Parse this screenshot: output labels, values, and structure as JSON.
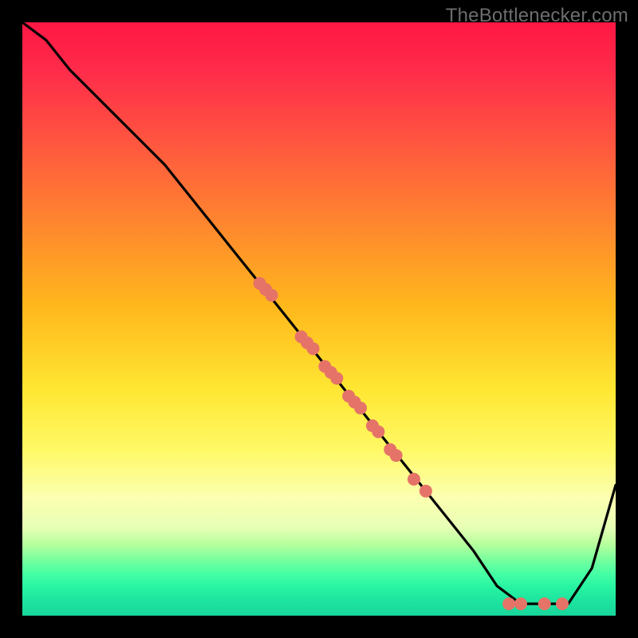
{
  "watermark": "TheBottlenecker.com",
  "colors": {
    "dot": "#e57368",
    "curve": "#000000",
    "frame_bg": "#000000"
  },
  "chart_data": {
    "type": "line",
    "title": "",
    "xlabel": "",
    "ylabel": "",
    "xlim": [
      0,
      100
    ],
    "ylim": [
      0,
      100
    ],
    "grid": false,
    "legend": false,
    "series": [
      {
        "name": "bottleneck-curve",
        "x": [
          0,
          4,
          8,
          12,
          16,
          20,
          24,
          28,
          32,
          36,
          40,
          44,
          48,
          52,
          56,
          60,
          64,
          68,
          72,
          76,
          80,
          84,
          88,
          92,
          96,
          100
        ],
        "y": [
          100,
          97,
          92,
          88,
          84,
          80,
          76,
          71,
          66,
          61,
          56,
          51,
          46,
          41,
          36,
          31,
          26,
          21,
          16,
          11,
          5,
          2,
          2,
          2,
          8,
          22
        ]
      }
    ],
    "scatter": [
      {
        "name": "points-on-curve",
        "points": [
          {
            "x": 40,
            "y": 56
          },
          {
            "x": 41,
            "y": 55
          },
          {
            "x": 42,
            "y": 54
          },
          {
            "x": 47,
            "y": 47
          },
          {
            "x": 48,
            "y": 46
          },
          {
            "x": 49,
            "y": 45
          },
          {
            "x": 51,
            "y": 42
          },
          {
            "x": 52,
            "y": 41
          },
          {
            "x": 53,
            "y": 40
          },
          {
            "x": 55,
            "y": 37
          },
          {
            "x": 56,
            "y": 36
          },
          {
            "x": 57,
            "y": 35
          },
          {
            "x": 59,
            "y": 32
          },
          {
            "x": 60,
            "y": 31
          },
          {
            "x": 62,
            "y": 28
          },
          {
            "x": 63,
            "y": 27
          },
          {
            "x": 66,
            "y": 23
          },
          {
            "x": 68,
            "y": 21
          },
          {
            "x": 82,
            "y": 2
          },
          {
            "x": 84,
            "y": 2
          },
          {
            "x": 88,
            "y": 2
          },
          {
            "x": 91,
            "y": 2
          }
        ]
      }
    ]
  }
}
